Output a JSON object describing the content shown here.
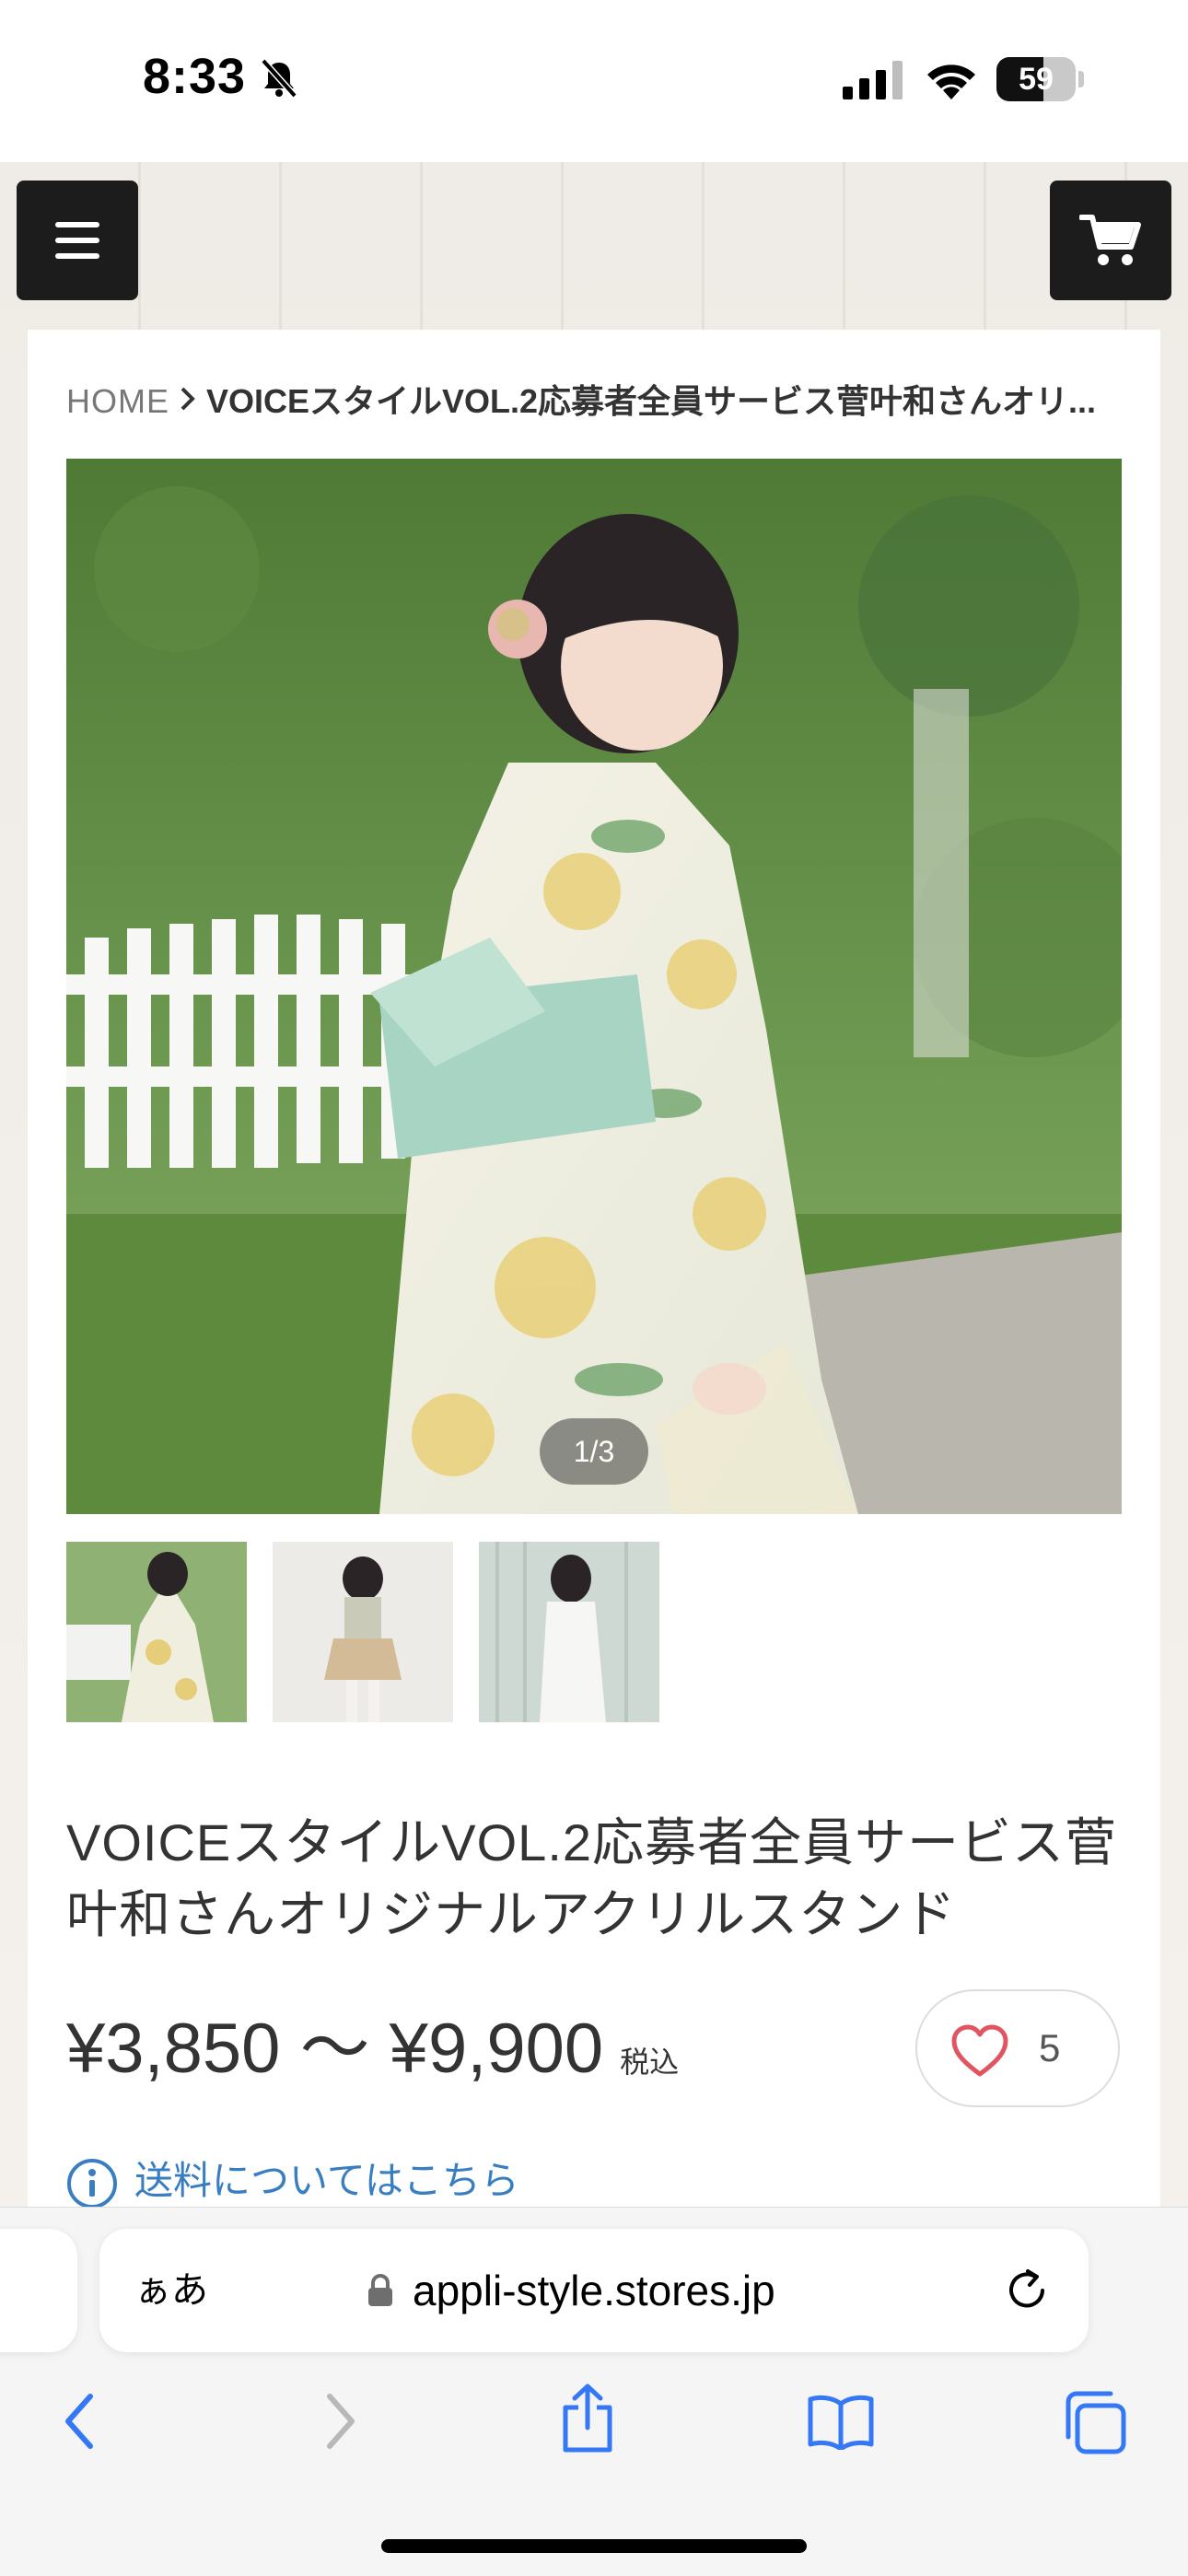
{
  "status_bar": {
    "time": "8:33",
    "battery": "59",
    "battery_level": 0.59,
    "icons": [
      "bell-slash-icon",
      "cellular-signal-icon",
      "wifi-icon",
      "battery-icon"
    ]
  },
  "header": {
    "menu_icon": "hamburger-icon",
    "cart_icon": "cart-icon"
  },
  "breadcrumb": {
    "home": "HOME",
    "current": "VOICEスタイルVOL.2応募者全員サービス菅叶和さんオリ..."
  },
  "gallery": {
    "counter": "1/3",
    "thumbnails": 3
  },
  "product": {
    "title": "VOICEスタイルVOL.2応募者全員サービス菅叶和さんオリジナルアクリルスタンド",
    "price": "¥3,850 〜 ¥9,900",
    "tax": "税込",
    "favorite_count": "5",
    "shipping_link": "送料についてはこちら"
  },
  "browser": {
    "reader_label": "ぁあ",
    "url": "appli-style.stores.jp",
    "toolbar_icons": [
      "back-icon",
      "forward-icon",
      "share-icon",
      "bookmarks-icon",
      "tabs-icon"
    ]
  },
  "colors": {
    "link": "#3a7ec2",
    "heart": "#e0555f",
    "header_button": "#1c1c1c",
    "safari_blue": "#3478f6"
  }
}
